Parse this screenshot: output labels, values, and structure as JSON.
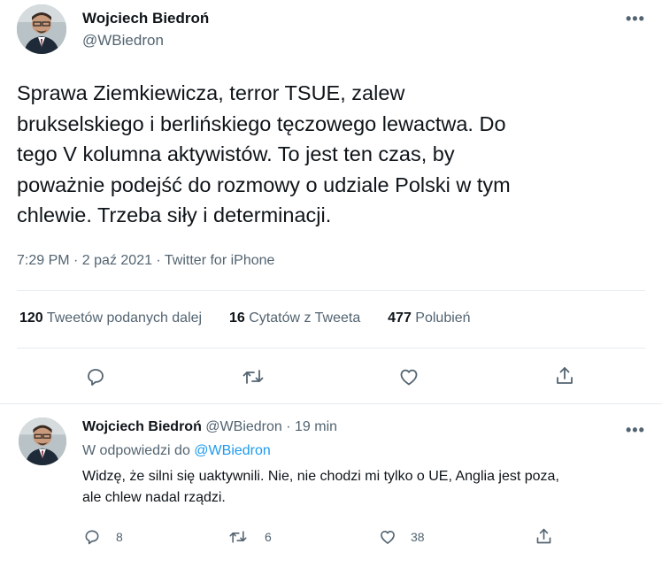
{
  "tweet": {
    "author_name": "Wojciech Biedroń",
    "author_handle": "@WBiedron",
    "more": "•••",
    "text_lines": [
      "Sprawa Ziemkiewicza, terror TSUE, zalew",
      "brukselskiego i berlińskiego tęczowego lewactwa. Do",
      "tego V kolumna aktywistów. To jest ten czas, by",
      "poważnie podejść do rozmowy o udziale Polski w tym",
      "chlewie. Trzeba siły i determinacji."
    ],
    "meta": "7:29 PM · 2 paź 2021 · Twitter for iPhone",
    "stats": {
      "retweets_count": "120",
      "retweets_label": "Tweetów podanych dalej",
      "quotes_count": "16",
      "quotes_label": "Cytatów z Tweeta",
      "likes_count": "477",
      "likes_label": "Polubień"
    },
    "actions": [
      "reply-icon",
      "retweet-icon",
      "like-icon",
      "share-icon"
    ]
  },
  "reply": {
    "author_name": "Wojciech Biedroń",
    "author_handle": "@WBiedron",
    "separator": "·",
    "time": "19 min",
    "more": "•••",
    "replying_prefix": "W odpowiedzi do",
    "replying_handle": "@WBiedron",
    "text_lines": [
      "Widzę, że silni się uaktywnili. Nie, nie chodzi mi tylko o UE, Anglia jest poza,",
      "ale chlew nadal rządzi."
    ],
    "counts": {
      "replies": "8",
      "retweets": "6",
      "likes": "38"
    }
  },
  "colors": {
    "text": "#0f1419",
    "muted": "#536471",
    "link": "#1d9bf0",
    "divider": "#e6ecf0"
  }
}
